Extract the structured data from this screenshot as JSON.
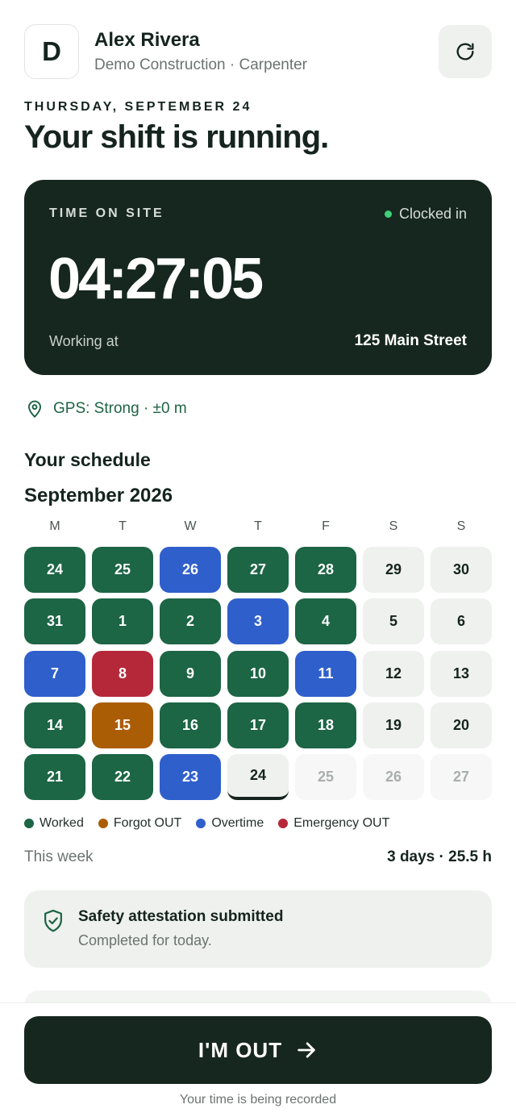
{
  "header": {
    "avatar_initial": "D",
    "name": "Alex Rivera",
    "subtitle": "Demo Construction · Carpenter",
    "refresh_icon": "refresh-icon"
  },
  "date_line": "THURSDAY, SEPTEMBER 24",
  "headline": "Your shift is running.",
  "timer": {
    "label": "TIME ON SITE",
    "status": "Clocked in",
    "value": "04:27:05",
    "working_label": "Working at",
    "site": "125 Main Street"
  },
  "gps": {
    "icon": "location-pin-icon",
    "text": "GPS: Strong · ±0 m"
  },
  "schedule": {
    "title": "Your schedule",
    "month": "September 2026",
    "weekdays": [
      "M",
      "T",
      "W",
      "T",
      "F",
      "S",
      "S"
    ],
    "weeks": [
      [
        {
          "d": "24",
          "s": "worked"
        },
        {
          "d": "25",
          "s": "worked"
        },
        {
          "d": "26",
          "s": "overtime"
        },
        {
          "d": "27",
          "s": "worked"
        },
        {
          "d": "28",
          "s": "worked"
        },
        {
          "d": "29",
          "s": "off"
        },
        {
          "d": "30",
          "s": "off"
        }
      ],
      [
        {
          "d": "31",
          "s": "worked"
        },
        {
          "d": "1",
          "s": "worked"
        },
        {
          "d": "2",
          "s": "worked"
        },
        {
          "d": "3",
          "s": "overtime"
        },
        {
          "d": "4",
          "s": "worked"
        },
        {
          "d": "5",
          "s": "off"
        },
        {
          "d": "6",
          "s": "off"
        }
      ],
      [
        {
          "d": "7",
          "s": "overtime"
        },
        {
          "d": "8",
          "s": "emergency"
        },
        {
          "d": "9",
          "s": "worked"
        },
        {
          "d": "10",
          "s": "worked"
        },
        {
          "d": "11",
          "s": "overtime"
        },
        {
          "d": "12",
          "s": "off"
        },
        {
          "d": "13",
          "s": "off"
        }
      ],
      [
        {
          "d": "14",
          "s": "worked"
        },
        {
          "d": "15",
          "s": "forgot"
        },
        {
          "d": "16",
          "s": "worked"
        },
        {
          "d": "17",
          "s": "worked"
        },
        {
          "d": "18",
          "s": "worked"
        },
        {
          "d": "19",
          "s": "off"
        },
        {
          "d": "20",
          "s": "off"
        }
      ],
      [
        {
          "d": "21",
          "s": "worked"
        },
        {
          "d": "22",
          "s": "worked"
        },
        {
          "d": "23",
          "s": "overtime"
        },
        {
          "d": "24",
          "s": "today"
        },
        {
          "d": "25",
          "s": "future"
        },
        {
          "d": "26",
          "s": "future"
        },
        {
          "d": "27",
          "s": "future"
        }
      ]
    ],
    "legend": [
      {
        "label": "Worked",
        "status": "worked"
      },
      {
        "label": "Forgot OUT",
        "status": "forgot"
      },
      {
        "label": "Overtime",
        "status": "overtime"
      },
      {
        "label": "Emergency OUT",
        "status": "emergency"
      }
    ],
    "colors": {
      "worked": "#1c6545",
      "forgot": "#ab5d06",
      "overtime": "#2f5fcb",
      "emergency": "#b5283a",
      "off": "#eef1ee",
      "today": "#eef1ee",
      "future": "#f6f7f6"
    },
    "week_label": "This week",
    "week_value": "3 days · 25.5 h"
  },
  "safety": {
    "icon": "shield-check-icon",
    "title": "Safety attestation submitted",
    "subtitle": "Completed for today."
  },
  "footer": {
    "button_label": "I'M OUT",
    "button_icon": "arrow-right-icon",
    "note": "Your time is being recorded"
  }
}
